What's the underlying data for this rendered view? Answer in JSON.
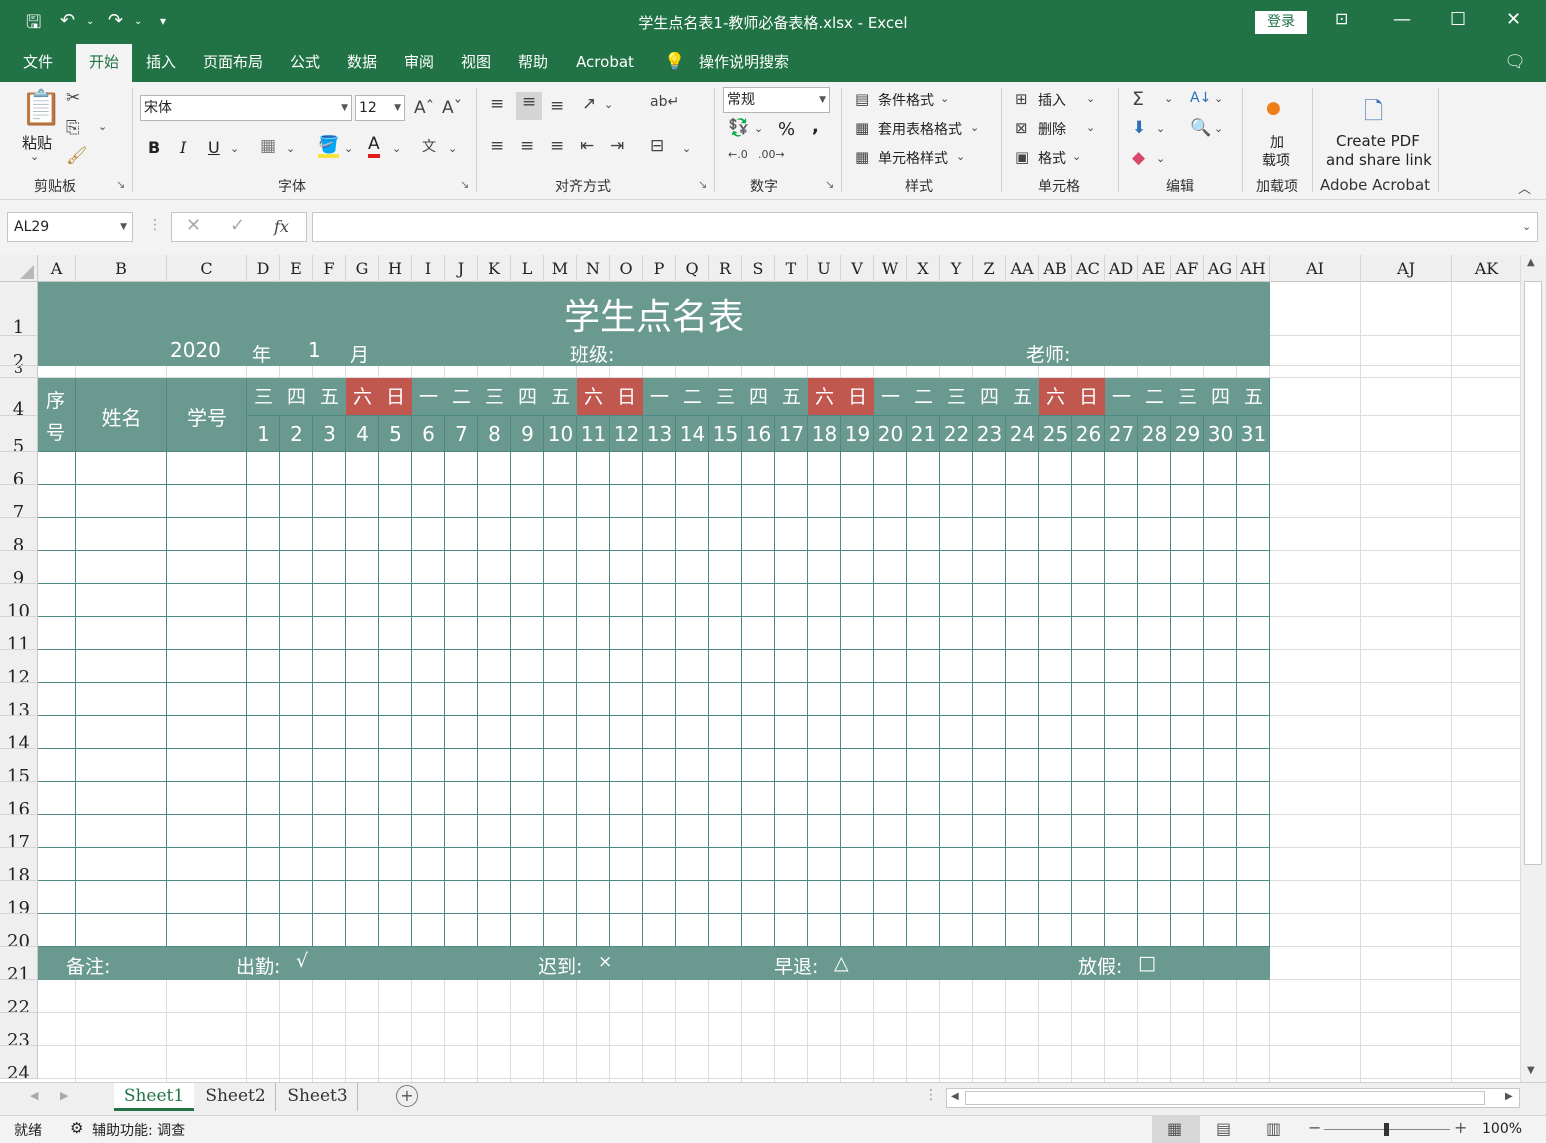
{
  "window": {
    "title": "学生点名表1-教师必备表格.xlsx  -  Excel",
    "login_label": "登录"
  },
  "menu": {
    "tabs": [
      "文件",
      "开始",
      "插入",
      "页面布局",
      "公式",
      "数据",
      "审阅",
      "视图",
      "帮助",
      "Acrobat"
    ],
    "active_tab": "开始",
    "tell_me": "操作说明搜索"
  },
  "ribbon": {
    "clipboard": {
      "paste": "粘贴",
      "group": "剪贴板"
    },
    "font": {
      "name": "宋体",
      "size": "12",
      "bold": "B",
      "italic": "I",
      "underline": "U",
      "font_color_glyph": "A",
      "group": "字体"
    },
    "align": {
      "group": "对齐方式"
    },
    "number": {
      "format": "常规",
      "percent": "%",
      "comma": ",",
      "group": "数字"
    },
    "styles": {
      "conditional": "条件格式",
      "table": "套用表格格式",
      "cell": "单元格样式",
      "group": "样式"
    },
    "cells": {
      "insert": "插入",
      "delete": "删除",
      "format": "格式",
      "group": "单元格"
    },
    "editing": {
      "group": "编辑"
    },
    "addins": {
      "line1": "加",
      "line2": "载项",
      "group": "加载项"
    },
    "acrobat": {
      "line1": "Create PDF",
      "line2": "and share link",
      "group": "Adobe Acrobat"
    }
  },
  "formula_bar": {
    "name_box": "AL29",
    "fx": "fx",
    "content": ""
  },
  "columns": [
    "A",
    "B",
    "C",
    "D",
    "E",
    "F",
    "G",
    "H",
    "I",
    "J",
    "K",
    "L",
    "M",
    "N",
    "O",
    "P",
    "Q",
    "R",
    "S",
    "T",
    "U",
    "V",
    "W",
    "X",
    "Y",
    "Z",
    "AA",
    "AB",
    "AC",
    "AD",
    "AE",
    "AF",
    "AG",
    "AH",
    "AI",
    "AJ",
    "AK"
  ],
  "rows": [
    "1",
    "2",
    "3",
    "4",
    "5",
    "6",
    "7",
    "8",
    "9",
    "10",
    "11",
    "12",
    "13",
    "14",
    "15",
    "16",
    "17",
    "18",
    "19",
    "20",
    "21",
    "22",
    "23",
    "24"
  ],
  "sheet": {
    "title": "学生点名表",
    "year": "2020",
    "year_label": "年",
    "month": "1",
    "month_label": "月",
    "class_label": "班级:",
    "teacher_label": "老师:",
    "hdr_seq_1": "序",
    "hdr_seq_2": "号",
    "hdr_name": "姓名",
    "hdr_id": "学号",
    "weekdays": [
      "三",
      "四",
      "五",
      "六",
      "日",
      "一",
      "二",
      "三",
      "四",
      "五",
      "六",
      "日",
      "一",
      "二",
      "三",
      "四",
      "五",
      "六",
      "日",
      "一",
      "二",
      "三",
      "四",
      "五",
      "六",
      "日",
      "一",
      "二",
      "三",
      "四",
      "五"
    ],
    "weekend_indices": [
      3,
      4,
      10,
      11,
      17,
      18,
      24,
      25
    ],
    "days": [
      "1",
      "2",
      "3",
      "4",
      "5",
      "6",
      "7",
      "8",
      "9",
      "10",
      "11",
      "12",
      "13",
      "14",
      "15",
      "16",
      "17",
      "18",
      "19",
      "20",
      "21",
      "22",
      "23",
      "24",
      "25",
      "26",
      "27",
      "28",
      "29",
      "30",
      "31"
    ],
    "notes_label": "备注:",
    "present_label": "出勤:",
    "present_sym": "√",
    "late_label": "迟到:",
    "late_sym": "×",
    "early_label": "早退:",
    "early_sym": "△",
    "leave_label": "放假:",
    "leave_sym": "□"
  },
  "colors": {
    "band": "#6a9a8f",
    "weekend": "#c0584f",
    "excel_green": "#217346"
  },
  "sheet_tabs": [
    "Sheet1",
    "Sheet2",
    "Sheet3"
  ],
  "active_sheet": "Sheet1",
  "status": {
    "ready": "就绪",
    "accessibility": "辅助功能: 调查",
    "zoom": "100%"
  }
}
